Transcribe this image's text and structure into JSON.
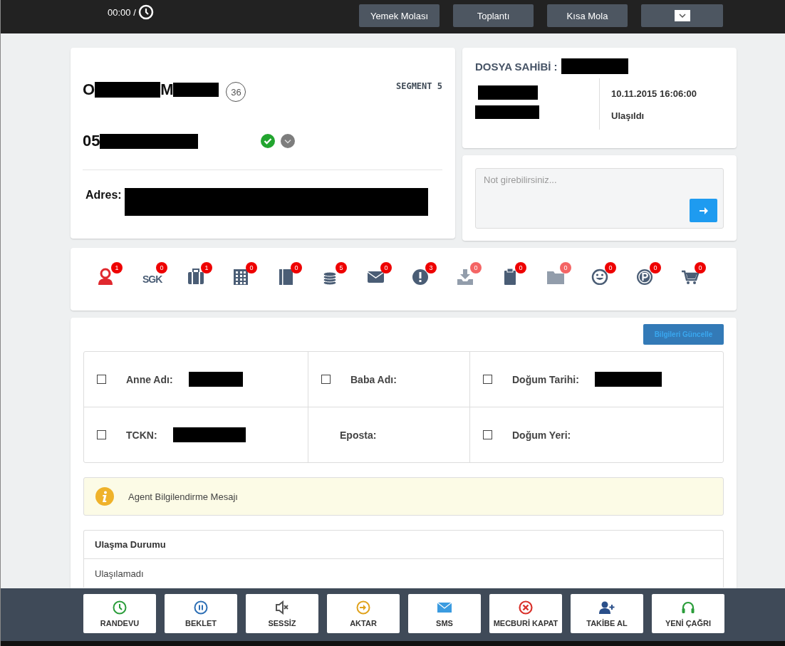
{
  "top_bar": {
    "timer": "00:00 /",
    "break_buttons": [
      "Yemek Molası",
      "Toplantı",
      "Kısa Mola"
    ]
  },
  "customer": {
    "name_initials": [
      "O",
      "M"
    ],
    "age": "36",
    "segment": "SEGMENT 5",
    "phone_prefix": "05",
    "phone_verified": true,
    "address_label": "Adres:"
  },
  "file_owner": {
    "label": "DOSYA SAHİBİ :",
    "date": "10.11.2015 16:06:00",
    "status": "Ulaşıldı"
  },
  "note": {
    "placeholder": "Not girebilirsiniz..."
  },
  "modules": [
    {
      "kind": "person",
      "count": "1",
      "dimmed": false
    },
    {
      "kind": "sgk",
      "label": "SGK",
      "count": "0",
      "dimmed": false
    },
    {
      "kind": "briefcase",
      "count": "1",
      "dimmed": false
    },
    {
      "kind": "building",
      "count": "0",
      "dimmed": false
    },
    {
      "kind": "book",
      "count": "0",
      "dimmed": false
    },
    {
      "kind": "coins",
      "count": "5",
      "dimmed": false
    },
    {
      "kind": "mail",
      "count": "0",
      "dimmed": false
    },
    {
      "kind": "alert",
      "count": "3",
      "dimmed": false
    },
    {
      "kind": "download",
      "count": "0",
      "dimmed": true
    },
    {
      "kind": "clipboard",
      "count": "0",
      "dimmed": false
    },
    {
      "kind": "folder",
      "count": "0",
      "dimmed": true
    },
    {
      "kind": "smile",
      "count": "0",
      "dimmed": false
    },
    {
      "kind": "parking",
      "count": "0",
      "dimmed": false
    },
    {
      "kind": "cart",
      "count": "0",
      "dimmed": false
    }
  ],
  "update_button": "Bilgileri Güncelle",
  "fields": [
    {
      "label": "Anne Adı:",
      "checked": false,
      "redacted": true
    },
    {
      "label": "Baba Adı:",
      "checked": false,
      "redacted": false
    },
    {
      "label": "Doğum Tarihi:",
      "checked": false,
      "redacted": true
    },
    {
      "label": "TCKN:",
      "checked": false,
      "redacted": true
    },
    {
      "label": "Eposta:",
      "redacted": false
    },
    {
      "label": "Doğum Yeri:",
      "checked": false,
      "redacted": false
    }
  ],
  "info_message": "Agent Bilgilendirme Mesajı",
  "reach_status": {
    "title": "Ulaşma Durumu",
    "value": "Ulaşılamadı"
  },
  "actions": [
    {
      "kind": "clock",
      "label": "RANDEVU",
      "color": "#2a9d3a"
    },
    {
      "kind": "pause",
      "label": "BEKLET",
      "color": "#2d6fb5"
    },
    {
      "kind": "mute",
      "label": "SESSİZ",
      "color": "#555555"
    },
    {
      "kind": "forward",
      "label": "AKTAR",
      "color": "#e0a21c"
    },
    {
      "kind": "mail",
      "label": "SMS",
      "color": "#3a9be0"
    },
    {
      "kind": "close",
      "label": "MECBURİ KAPAT",
      "color": "#d9312b"
    },
    {
      "kind": "adduser",
      "label": "TAKİBE AL",
      "color": "#2a4f8a"
    },
    {
      "kind": "headset",
      "label": "YENİ ÇAĞRI",
      "color": "#2a9d3a"
    }
  ]
}
